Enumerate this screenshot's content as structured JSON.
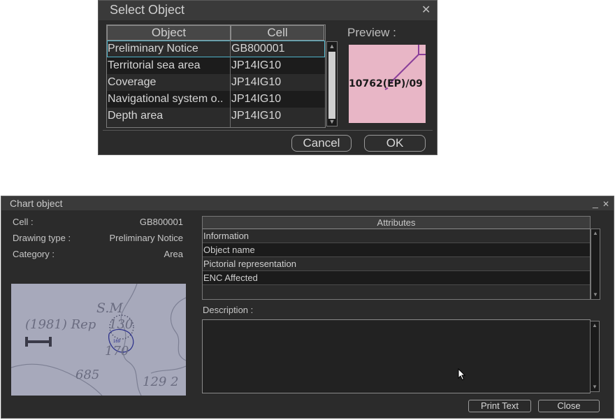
{
  "select_dialog": {
    "title": "Select Object",
    "close_icon": "close-icon",
    "columns": [
      "Object",
      "Cell"
    ],
    "rows": [
      {
        "object": "Preliminary Notice",
        "cell": "GB800001"
      },
      {
        "object": "Territorial sea area",
        "cell": "JP14IG10"
      },
      {
        "object": "Coverage",
        "cell": "JP14IG10"
      },
      {
        "object": "Navigational system o..",
        "cell": "JP14IG10"
      },
      {
        "object": "Depth area",
        "cell": "JP14IG10"
      }
    ],
    "selected_row": 0,
    "preview_label": "Preview :",
    "preview_text": "10762(EP)/09",
    "preview_color": "#e8b6c6",
    "cancel_label": "Cancel",
    "ok_label": "OK"
  },
  "chart_object": {
    "title": "Chart object",
    "cell_label": "Cell :",
    "cell_value": "GB800001",
    "drawing_type_label": "Drawing type :",
    "drawing_type_value": "Preliminary Notice",
    "category_label": "Category :",
    "category_value": "Area",
    "attributes_header": "Attributes",
    "attributes": [
      "Information",
      "Object name",
      "Pictorial representation",
      "ENC Affected"
    ],
    "description_label": "Description :",
    "description_value": "",
    "print_label": "Print Text",
    "close_label": "Close",
    "map_labels": {
      "sm": "S.M",
      "rep": "(1981) Rep",
      "d130": "130",
      "d170": "170",
      "d685": "685",
      "d1292": "129 2",
      "small": "169"
    }
  }
}
